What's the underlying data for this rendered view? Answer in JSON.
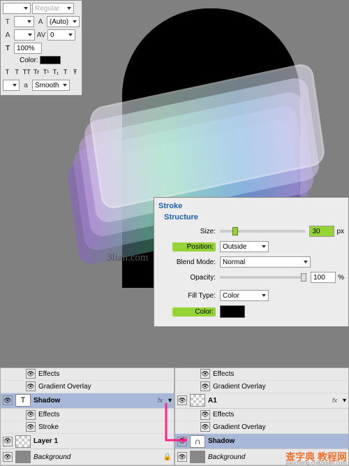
{
  "char_panel": {
    "font_style": "Regular",
    "leading": "(Auto)",
    "tracking": "0",
    "scale": "100%",
    "color_label": "Color:",
    "aa_label": "Smooth",
    "aa_prefix": "a"
  },
  "canvas": {
    "watermark": "3lian.com"
  },
  "stroke": {
    "title": "Stroke",
    "structure": "Structure",
    "size_label": "Size:",
    "size_value": "30",
    "size_unit": "px",
    "position_label": "Position:",
    "position_value": "Outside",
    "blend_label": "Blend Mode:",
    "blend_value": "Normal",
    "opacity_label": "Opacity:",
    "opacity_value": "100",
    "opacity_unit": "%",
    "filltype_label": "Fill Type:",
    "filltype_value": "Color",
    "color_label": "Color:"
  },
  "layers_left": {
    "effects": "Effects",
    "gradient": "Gradient Overlay",
    "shadow": "Shadow",
    "stroke_fx": "Stroke",
    "layer1": "Layer 1",
    "bg": "Background"
  },
  "layers_right": {
    "effects": "Effects",
    "gradient": "Gradient Overlay",
    "a1": "A1",
    "shadow": "Shadow",
    "bg": "Background"
  },
  "fx_label": "fx",
  "footer_wm": "查字典 教程网",
  "footer_url": "jiaocheng.chazidian.com"
}
